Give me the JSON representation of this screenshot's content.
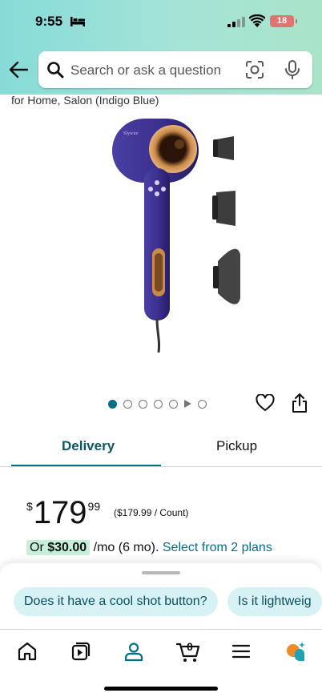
{
  "status_bar": {
    "time": "9:55",
    "battery": "18",
    "icons": [
      "bed-icon",
      "cellular-signal-icon",
      "wifi-icon",
      "battery-icon"
    ]
  },
  "search": {
    "placeholder": "Search or ask a question",
    "icons": [
      "back-arrow-icon",
      "search-icon",
      "camera-lens-icon",
      "microphone-icon"
    ]
  },
  "product": {
    "title_fragment": "for Home, Salon (Indigo Blue)",
    "image_count": 6,
    "has_video": true,
    "image_dots_active_index": 0
  },
  "tabs": {
    "items": [
      {
        "label": "Delivery",
        "selected": true
      },
      {
        "label": "Pickup",
        "selected": false
      }
    ]
  },
  "price": {
    "currency_symbol": "$",
    "whole": "179",
    "fraction": "99",
    "unit_price": "($179.99 / Count)"
  },
  "installment": {
    "prefix": "Or",
    "amount": "$30.00",
    "term": "/mo (6 mo).",
    "link": "Select from 2 plans"
  },
  "suggestions": [
    "Does it have a cool shot button?",
    "Is it lightweig"
  ],
  "bottom_nav": {
    "items": [
      "home-icon",
      "inspire-video-icon",
      "account-icon",
      "cart-icon",
      "menu-icon",
      "rufus-assistant-icon"
    ],
    "cart_count": "0",
    "selected": "account-icon"
  },
  "colors": {
    "accent": "#007185",
    "header_gradient_start": "#86dbd9",
    "header_gradient_end": "#a9e4c9",
    "chip_bg": "#d7f2f5",
    "installment_badge": "#c6eed8",
    "product_body": "#3b2f8f",
    "product_accent": "#c98a4a"
  }
}
